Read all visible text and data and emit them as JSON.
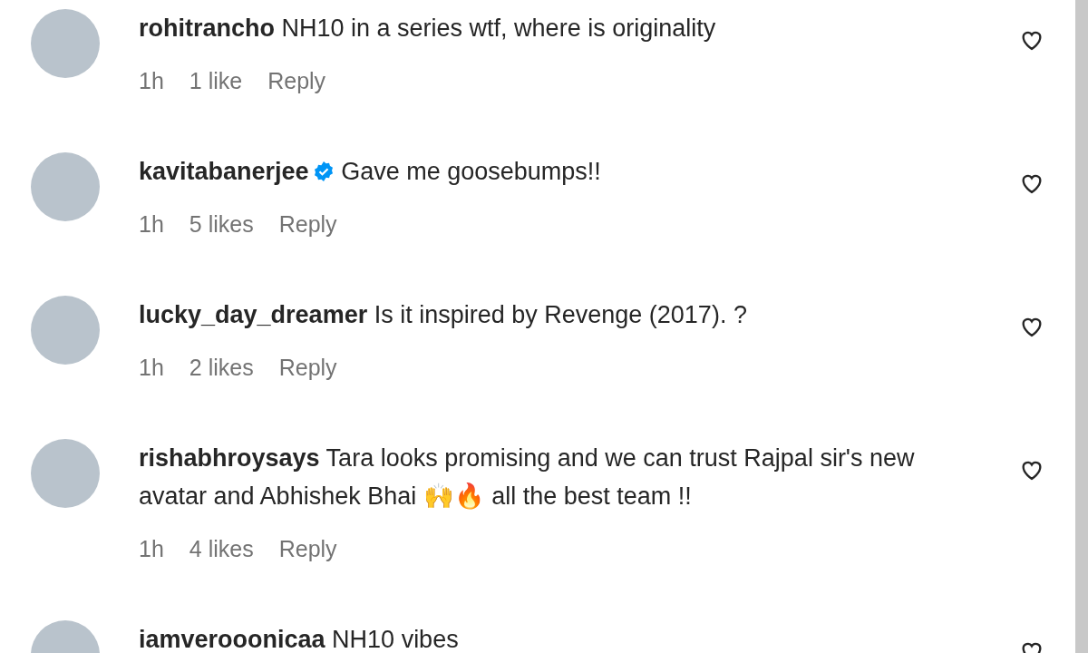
{
  "comments": [
    {
      "username": "rohitrancho",
      "verified": false,
      "text": "NH10 in a series wtf, where is originality",
      "time": "1h",
      "likes": "1 like",
      "reply": "Reply",
      "liked": false
    },
    {
      "username": "kavitabanerjee",
      "verified": true,
      "text": "Gave me goosebumps!!",
      "time": "1h",
      "likes": "5 likes",
      "reply": "Reply",
      "liked": false
    },
    {
      "username": "lucky_day_dreamer",
      "verified": false,
      "text": "Is it inspired by Revenge (2017). ?",
      "time": "1h",
      "likes": "2 likes",
      "reply": "Reply",
      "liked": false
    },
    {
      "username": "rishabhroysays",
      "verified": false,
      "text": "Tara looks promising and we can trust Rajpal sir's new avatar and Abhishek Bhai 🙌🔥 all the best team !!",
      "time": "1h",
      "likes": "4 likes",
      "reply": "Reply",
      "liked": false
    },
    {
      "username": "iamverooonicaa",
      "verified": false,
      "text": "NH10 vibes",
      "liked": false
    }
  ]
}
